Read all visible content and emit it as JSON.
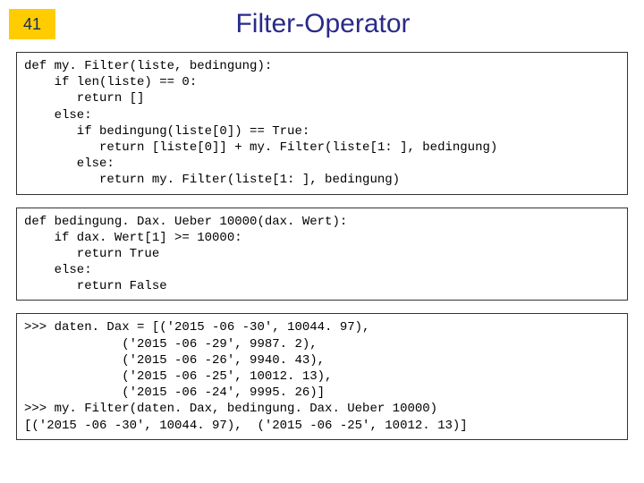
{
  "slide": {
    "number": "41",
    "title": "Filter-Operator"
  },
  "code_blocks": {
    "block1": "def my. Filter(liste, bedingung):\n    if len(liste) == 0:\n       return []\n    else:\n       if bedingung(liste[0]) == True:\n          return [liste[0]] + my. Filter(liste[1: ], bedingung)\n       else:\n          return my. Filter(liste[1: ], bedingung)",
    "block2": "def bedingung. Dax. Ueber 10000(dax. Wert):\n    if dax. Wert[1] >= 10000:\n       return True\n    else:\n       return False",
    "block3": ">>> daten. Dax = [('2015 -06 -30', 10044. 97),\n             ('2015 -06 -29', 9987. 2),\n             ('2015 -06 -26', 9940. 43),\n             ('2015 -06 -25', 10012. 13),\n             ('2015 -06 -24', 9995. 26)]\n>>> my. Filter(daten. Dax, bedingung. Dax. Ueber 10000)\n[('2015 -06 -30', 10044. 97),  ('2015 -06 -25', 10012. 13)]"
  }
}
